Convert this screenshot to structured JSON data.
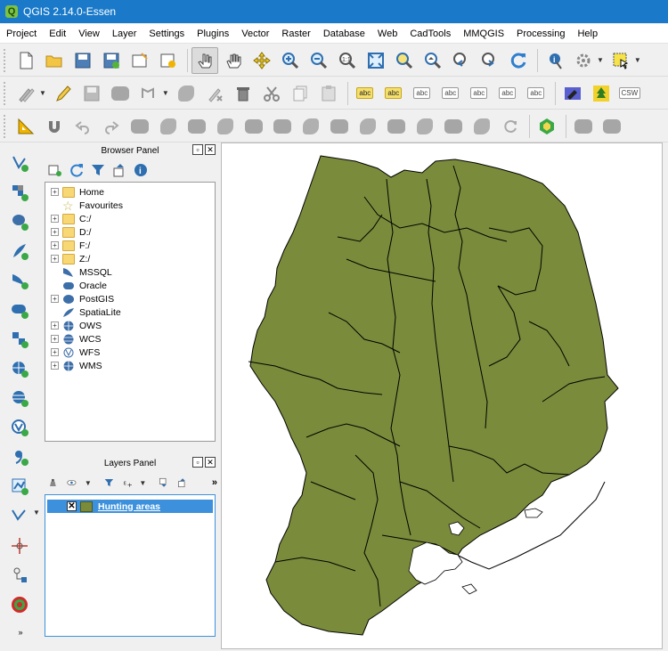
{
  "window": {
    "title": "QGIS 2.14.0-Essen"
  },
  "menu": [
    "Project",
    "Edit",
    "View",
    "Layer",
    "Settings",
    "Plugins",
    "Vector",
    "Raster",
    "Database",
    "Web",
    "CadTools",
    "MMQGIS",
    "Processing",
    "Help"
  ],
  "browser_panel": {
    "title": "Browser Panel",
    "items": [
      {
        "label": "Home",
        "icon": "folder-icon",
        "expandable": true
      },
      {
        "label": "Favourites",
        "icon": "star-icon",
        "expandable": false
      },
      {
        "label": "C:/",
        "icon": "folder-icon",
        "expandable": true
      },
      {
        "label": "D:/",
        "icon": "folder-icon",
        "expandable": true
      },
      {
        "label": "F:/",
        "icon": "folder-icon",
        "expandable": true
      },
      {
        "label": "Z:/",
        "icon": "folder-icon",
        "expandable": true
      },
      {
        "label": "MSSQL",
        "icon": "mssql-icon",
        "expandable": false
      },
      {
        "label": "Oracle",
        "icon": "oracle-icon",
        "expandable": false
      },
      {
        "label": "PostGIS",
        "icon": "postgis-icon",
        "expandable": true
      },
      {
        "label": "SpatiaLite",
        "icon": "spatialite-icon",
        "expandable": false
      },
      {
        "label": "OWS",
        "icon": "globe-icon",
        "expandable": true
      },
      {
        "label": "WCS",
        "icon": "globe-icon",
        "expandable": true
      },
      {
        "label": "WFS",
        "icon": "wfs-icon",
        "expandable": true
      },
      {
        "label": "WMS",
        "icon": "globe-icon",
        "expandable": true
      }
    ]
  },
  "layers_panel": {
    "title": "Layers Panel",
    "layers": [
      {
        "name": "Hunting areas",
        "visible": true,
        "color": "#7a8c3b"
      }
    ]
  },
  "map": {
    "fill_color": "#7a8c3b",
    "stroke_color": "#000000"
  },
  "colors": {
    "titlebar": "#1a7ac9",
    "selection": "#3d91dc"
  }
}
